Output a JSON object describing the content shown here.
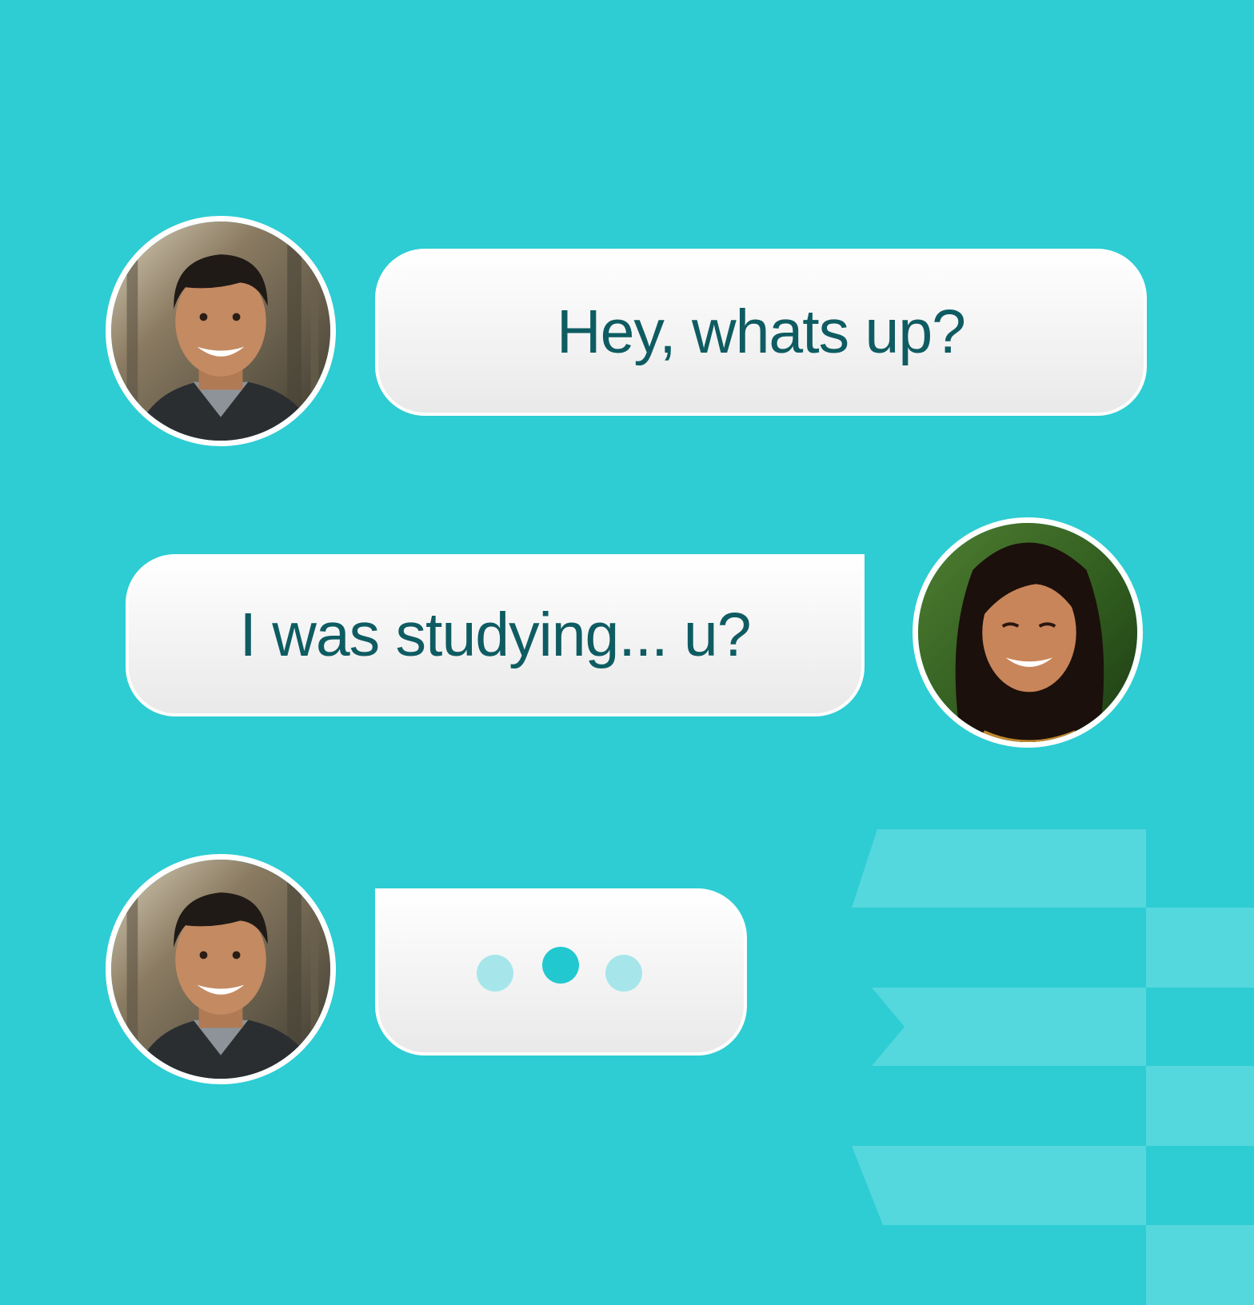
{
  "colors": {
    "background": "#2dcdd3",
    "decoration": "#55d7de",
    "bubble_text": "#0e5c62",
    "dot_light": "#a6e6ea",
    "dot_active": "#22c8cf"
  },
  "messages": [
    {
      "sender": "left",
      "text": "Hey, whats up?"
    },
    {
      "sender": "right",
      "text": "I was studying... u?"
    },
    {
      "sender": "left",
      "typing": true
    }
  ],
  "avatars": {
    "left": {
      "icon": "man-smiling-avatar"
    },
    "right": {
      "icon": "woman-smiling-avatar"
    }
  },
  "typing_indicator": {
    "dots": 3,
    "active_dot": 2
  }
}
